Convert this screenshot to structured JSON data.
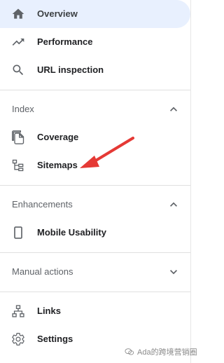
{
  "sidebar": {
    "top_items": [
      {
        "label": "Overview",
        "icon": "home-icon",
        "active": true
      },
      {
        "label": "Performance",
        "icon": "trending-up-icon"
      },
      {
        "label": "URL inspection",
        "icon": "search-icon"
      }
    ],
    "sections": [
      {
        "title": "Index",
        "expanded": true,
        "items": [
          {
            "label": "Coverage",
            "icon": "coverage-icon"
          },
          {
            "label": "Sitemaps",
            "icon": "sitemap-icon"
          }
        ]
      },
      {
        "title": "Enhancements",
        "expanded": true,
        "items": [
          {
            "label": "Mobile Usability",
            "icon": "smartphone-icon"
          }
        ]
      },
      {
        "title": "Manual actions",
        "expanded": false,
        "items": []
      }
    ],
    "bottom_items": [
      {
        "label": "Links",
        "icon": "links-icon"
      },
      {
        "label": "Settings",
        "icon": "gear-icon"
      }
    ]
  },
  "annotation": {
    "arrow_color": "#e53935",
    "points_to": "Sitemaps"
  },
  "watermark": {
    "text": "Ada的跨境营销圈"
  },
  "colors": {
    "active_bg": "#e8f0fe",
    "text": "#202124",
    "section_text": "#5f6368",
    "icon": "#5f6368",
    "divider": "#e0e0e0"
  }
}
